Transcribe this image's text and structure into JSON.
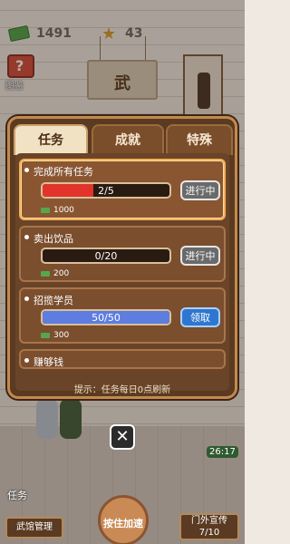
{
  "hud": {
    "money": "1491",
    "stars": "43"
  },
  "scene": {
    "sign": "武",
    "handbook": "图鉴"
  },
  "panel": {
    "tabs": [
      "任务",
      "成就",
      "特殊"
    ],
    "tasks": [
      {
        "title": "完成所有任务",
        "progress": "2/5",
        "fraction": 0.4,
        "reward": "1000",
        "button": "进行中",
        "state": "in_progress"
      },
      {
        "title": "卖出饮品",
        "progress": "0/20",
        "fraction": 0.0,
        "reward": "200",
        "button": "进行中",
        "state": "in_progress"
      },
      {
        "title": "招揽学员",
        "progress": "50/50",
        "fraction": 1.0,
        "reward": "300",
        "button": "领取",
        "state": "claim"
      },
      {
        "title": "赚够钱"
      }
    ],
    "hint": "提示：任务每日0点刷新"
  },
  "bottom": {
    "task_label": "任务",
    "gym_manage": "武馆管理",
    "speedup": "按住加速",
    "promote": "门外宣传",
    "promote_count": "7/10",
    "timer": "26:17"
  },
  "colors": {
    "red_fill": "#e2342b",
    "blue_fill": "#5d7ee0",
    "accent": "#f2b05a"
  }
}
